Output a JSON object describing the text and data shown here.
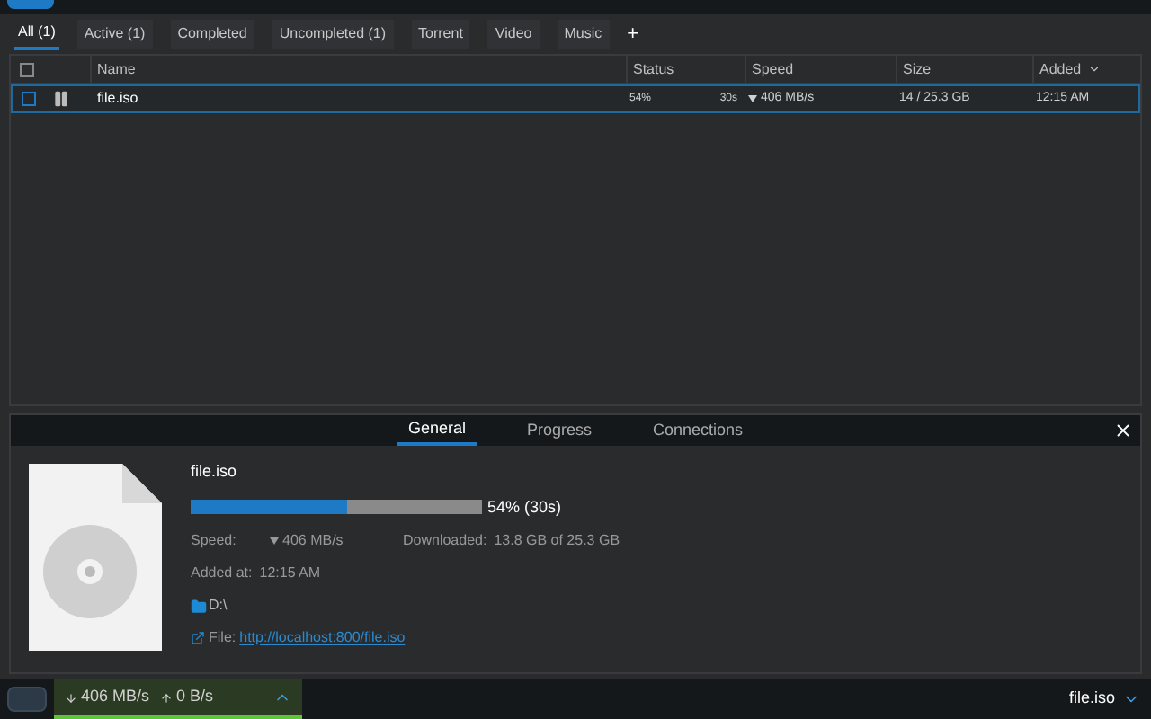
{
  "tabs": [
    {
      "label": "All (1)",
      "selected": true
    },
    {
      "label": "Active (1)",
      "selected": false
    },
    {
      "label": "Completed",
      "selected": false
    },
    {
      "label": "Uncompleted (1)",
      "selected": false
    },
    {
      "label": "Torrent",
      "selected": false
    },
    {
      "label": "Video",
      "selected": false
    },
    {
      "label": "Music",
      "selected": false
    }
  ],
  "add_tab": "+",
  "table": {
    "select_all_checked": false,
    "columns": [
      "Name",
      "Status",
      "Speed",
      "Size",
      "Added"
    ],
    "rows": [
      {
        "checked": false,
        "selected": true,
        "name": "file.iso",
        "percent": "54%",
        "eta": "30s",
        "speed": "406 MB/s",
        "size": "14 / 25.3 GB",
        "added": "12:15 AM"
      }
    ]
  },
  "details": {
    "tabs": [
      {
        "label": "General",
        "selected": true
      },
      {
        "label": "Progress",
        "selected": false
      },
      {
        "label": "Connections",
        "selected": false
      }
    ],
    "file_name": "file.iso",
    "level": 0.54,
    "progress_text": "54% (30s)",
    "speed_label": "Speed:",
    "speed": "406 MB/s",
    "downloaded_label": "Downloaded:",
    "downloaded": "13.8 GB of 25.3 GB",
    "added_label": "Added at:",
    "added": "12:15 AM",
    "folder": "D:\\",
    "file_label": "File:",
    "url": "http://localhost:800/file.iso"
  },
  "status_bar": {
    "down": "406 MB/s",
    "up": "0 B/s",
    "current": "file.iso"
  }
}
